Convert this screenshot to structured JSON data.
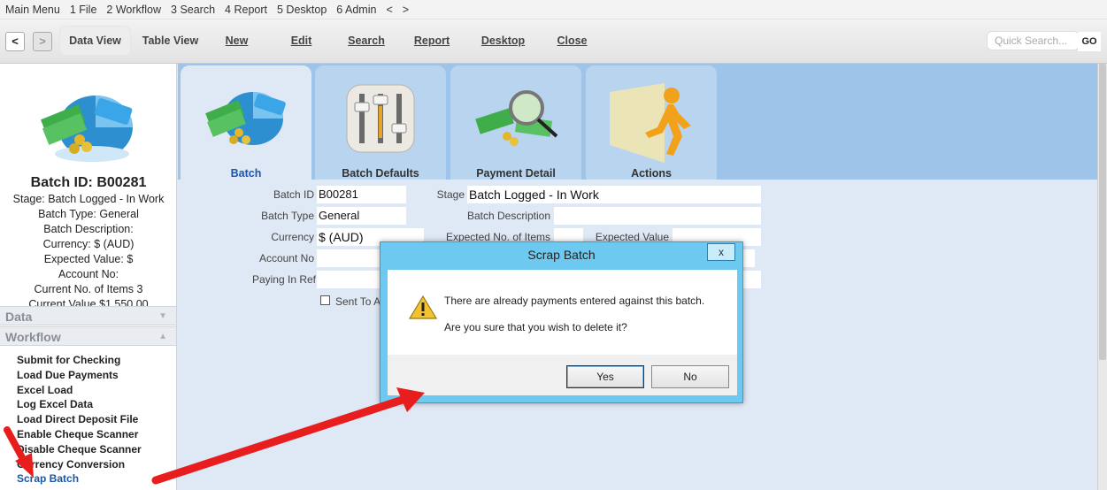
{
  "menubar": {
    "items": [
      "Main Menu",
      "1 File",
      "2 Workflow",
      "3 Search",
      "4 Report",
      "5 Desktop",
      "6 Admin",
      "<",
      ">"
    ]
  },
  "toolbar": {
    "back": "<",
    "forward": ">",
    "data_view": "Data View",
    "table_view": "Table View",
    "new": "New",
    "edit": "Edit",
    "search": "Search",
    "report": "Report",
    "desktop": "Desktop",
    "close": "Close",
    "quick_search_placeholder": "Quick Search...",
    "go": "GO"
  },
  "sidebar": {
    "batch_id": "Batch ID: B00281",
    "info_lines": [
      "Stage: Batch Logged - In Work",
      "Batch Type: General",
      "Batch Description:",
      "Currency: $ (AUD)",
      "Expected Value: $",
      "Account No:",
      "Current No. of Items 3",
      "Current Value $1,550.00"
    ],
    "data_header": "Data",
    "workflow_header": "Workflow",
    "workflow_items": [
      "Submit for Checking",
      "Load Due Payments",
      "Excel Load",
      "Log Excel Data",
      "Load Direct Deposit File",
      "Enable Cheque Scanner",
      "Disable Cheque Scanner",
      "Currency Conversion",
      "Scrap Batch"
    ]
  },
  "tabs": [
    "Batch",
    "Batch Defaults",
    "Payment Detail",
    "Actions"
  ],
  "form": {
    "batch_id_label": "Batch ID",
    "batch_id_value": "B00281",
    "batch_type_label": "Batch Type",
    "batch_type_value": "General",
    "currency_label": "Currency",
    "currency_value": "$ (AUD)",
    "account_no_label": "Account No",
    "paying_in_ref_label": "Paying In Ref",
    "sent_to_label": "Sent To Ac",
    "stage_label": "Stage",
    "stage_value": "Batch Logged - In Work",
    "batch_description_label": "Batch Description",
    "expected_items_label": "Expected No. of Items",
    "expected_value_label": "Expected Value"
  },
  "dialog": {
    "title": "Scrap Batch",
    "close": "x",
    "message1": "There are already payments entered against this batch.",
    "message2": "Are you sure that you wish to delete it?",
    "yes": "Yes",
    "no": "No"
  },
  "colors": {
    "annotation_arrow": "#e81e1e",
    "dialog_frame": "#6ec9f0",
    "tab_strip": "#9ec4ea",
    "link_blue": "#1a57a6"
  }
}
